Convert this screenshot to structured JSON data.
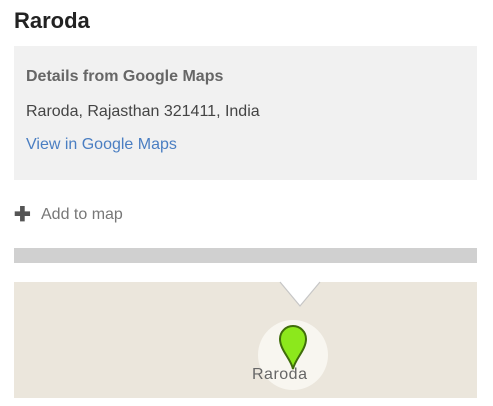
{
  "place": {
    "title": "Raroda"
  },
  "details": {
    "heading": "Details from Google Maps",
    "address": "Raroda, Rajasthan 321411, India",
    "link_label": "View in Google Maps"
  },
  "actions": {
    "add_to_map_label": "Add to map",
    "add_icon": "plus-icon"
  },
  "map": {
    "place_label": "Raroda",
    "marker_icon": "map-pin-icon",
    "marker_color": "#8ce81c",
    "background_color": "#ebe6dc"
  },
  "colors": {
    "link": "#4a7ec2",
    "details_background": "#f1f1f1"
  }
}
